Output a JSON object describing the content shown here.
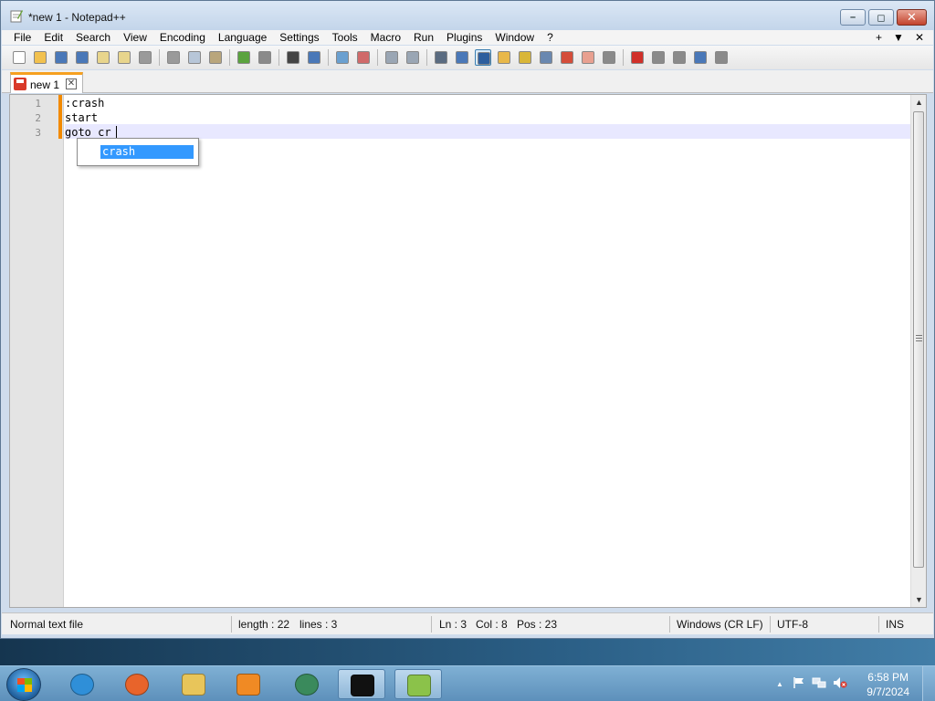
{
  "window": {
    "title": "*new 1 - Notepad++",
    "minimize_glyph": "–",
    "maximize_glyph": "◻",
    "close_glyph": "✕"
  },
  "menu": {
    "items": [
      "File",
      "Edit",
      "Search",
      "View",
      "Encoding",
      "Language",
      "Settings",
      "Tools",
      "Macro",
      "Run",
      "Plugins",
      "Window",
      "?"
    ],
    "right": [
      "+",
      "▼",
      "✕"
    ]
  },
  "toolbar": {
    "icons": [
      {
        "name": "new-file-icon",
        "color": "#ffffff"
      },
      {
        "name": "open-file-icon",
        "color": "#f2c14e"
      },
      {
        "name": "save-icon",
        "color": "#4a78b8"
      },
      {
        "name": "save-all-icon",
        "color": "#4a78b8"
      },
      {
        "name": "close-icon",
        "color": "#e8d58c"
      },
      {
        "name": "close-all-icon",
        "color": "#e8d58c"
      },
      {
        "name": "print-icon",
        "color": "#9a9a9a"
      },
      {
        "sep": true
      },
      {
        "name": "cut-icon",
        "color": "#9a9a9a"
      },
      {
        "name": "copy-icon",
        "color": "#b7c6d8"
      },
      {
        "name": "paste-icon",
        "color": "#b9a67c"
      },
      {
        "sep": true
      },
      {
        "name": "undo-icon",
        "color": "#5aa33e"
      },
      {
        "name": "redo-icon",
        "color": "#8a8a8a"
      },
      {
        "sep": true
      },
      {
        "name": "find-icon",
        "color": "#444444"
      },
      {
        "name": "replace-icon",
        "color": "#4a78b8"
      },
      {
        "sep": true
      },
      {
        "name": "zoom-in-icon",
        "color": "#6aa0d0"
      },
      {
        "name": "zoom-out-icon",
        "color": "#d06a6a"
      },
      {
        "sep": true
      },
      {
        "name": "sync-vertical-icon",
        "color": "#9aa6b4"
      },
      {
        "name": "sync-horizontal-icon",
        "color": "#9aa6b4"
      },
      {
        "sep": true
      },
      {
        "name": "word-wrap-icon",
        "color": "#5a6b80"
      },
      {
        "name": "show-all-chars-icon",
        "color": "#4a78b8"
      },
      {
        "name": "indent-guide-icon",
        "color": "#2d5e9e",
        "active": true
      },
      {
        "name": "user-language-icon",
        "color": "#e8b84a"
      },
      {
        "name": "doc-map-icon",
        "color": "#d9b638"
      },
      {
        "name": "doc-list-icon",
        "color": "#6a88b0"
      },
      {
        "name": "function-list-icon",
        "color": "#d44d3a"
      },
      {
        "name": "folder-workspace-icon",
        "color": "#e8a090"
      },
      {
        "name": "monitoring-icon",
        "color": "#8a8a8a"
      },
      {
        "sep": true
      },
      {
        "name": "record-macro-icon",
        "color": "#d0302a"
      },
      {
        "name": "stop-record-icon",
        "color": "#8a8a8a"
      },
      {
        "name": "play-macro-icon",
        "color": "#8a8a8a"
      },
      {
        "name": "run-macro-multiple-icon",
        "color": "#4a78b8"
      },
      {
        "name": "save-macro-icon",
        "color": "#8a8a8a"
      }
    ]
  },
  "tab": {
    "label": "new 1",
    "close": "✕"
  },
  "editor": {
    "lines": [
      {
        "num": "1",
        "text": ":crash"
      },
      {
        "num": "2",
        "text": "start"
      },
      {
        "num": "3",
        "text": "goto cr"
      }
    ],
    "autocomplete": [
      "crash"
    ],
    "scroll_up": "▲",
    "scroll_down": "▼"
  },
  "status": {
    "file_type": "Normal text file",
    "length": "length : 22",
    "lines": "lines : 3",
    "ln": "Ln : 3",
    "col": "Col : 8",
    "pos": "Pos : 23",
    "eol": "Windows (CR LF)",
    "encoding": "UTF-8",
    "mode": "INS"
  },
  "taskbar": {
    "apps": [
      {
        "name": "internet-explorer-icon",
        "color": "#2f8fd8",
        "running": false
      },
      {
        "name": "firefox-icon",
        "color": "#e8642b",
        "running": false
      },
      {
        "name": "file-explorer-icon",
        "color": "#e8c55a",
        "running": false
      },
      {
        "name": "media-player-icon",
        "color": "#f08a24",
        "running": false
      },
      {
        "name": "chrome-icon",
        "color": "#3a8a5c",
        "running": false
      },
      {
        "name": "command-prompt-icon",
        "color": "#111111",
        "running": true
      },
      {
        "name": "notepad-plus-plus-icon",
        "color": "#8bc24a",
        "running": true
      }
    ],
    "clock_time": "6:58 PM",
    "clock_date": "9/7/2024",
    "tray_up": "▲"
  }
}
